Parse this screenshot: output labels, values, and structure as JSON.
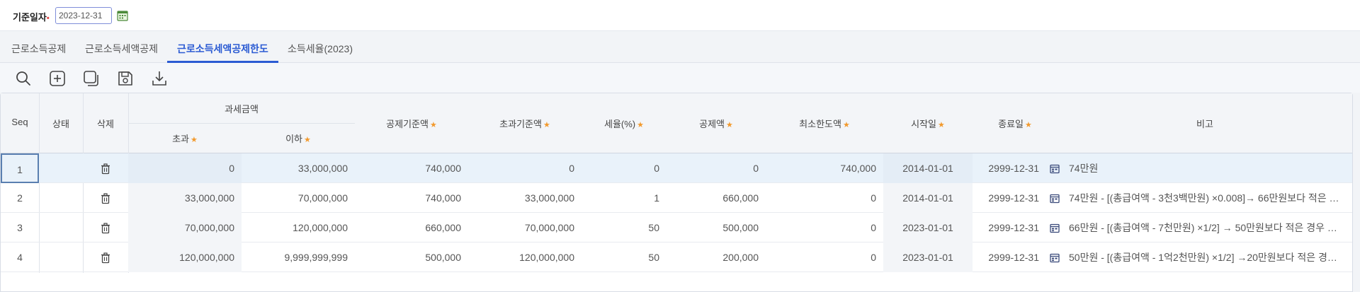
{
  "filter": {
    "label": "기준일자",
    "required_mark": "•",
    "date_value": "2023-12-31"
  },
  "tabs": [
    {
      "label": "근로소득공제"
    },
    {
      "label": "근로소득세액공제"
    },
    {
      "label": "근로소득세액공제한도"
    },
    {
      "label": "소득세율(2023)"
    }
  ],
  "active_tab": 2,
  "toolbar": {
    "icons": [
      "search-icon",
      "add-icon",
      "copy-icon",
      "save-icon",
      "download-icon"
    ]
  },
  "grid": {
    "headers": {
      "seq": "Seq",
      "status": "상태",
      "delete": "삭제",
      "taxable_group": "과세금액",
      "over": "초과",
      "under": "이하",
      "base_amount": "공제기준액",
      "excess_base": "초과기준액",
      "tax_rate": "세율(%)",
      "deduction": "공제액",
      "min_limit": "최소한도액",
      "start_date": "시작일",
      "end_date": "종료일",
      "note": "비고"
    },
    "required_star": "★",
    "rows": [
      {
        "seq": "1",
        "status": "",
        "over": "0",
        "under": "33,000,000",
        "base_amount": "740,000",
        "excess_base": "0",
        "tax_rate": "0",
        "deduction": "0",
        "min_limit": "740,000",
        "start_date": "2014-01-01",
        "end_date": "2999-12-31",
        "note": "74만원"
      },
      {
        "seq": "2",
        "status": "",
        "over": "33,000,000",
        "under": "70,000,000",
        "base_amount": "740,000",
        "excess_base": "33,000,000",
        "tax_rate": "1",
        "deduction": "660,000",
        "min_limit": "0",
        "start_date": "2014-01-01",
        "end_date": "2999-12-31",
        "note": "74만원 - [(총급여액 - 3천3백만원) ×0.008]→ 66만원보다 적은 …"
      },
      {
        "seq": "3",
        "status": "",
        "over": "70,000,000",
        "under": "120,000,000",
        "base_amount": "660,000",
        "excess_base": "70,000,000",
        "tax_rate": "50",
        "deduction": "500,000",
        "min_limit": "0",
        "start_date": "2023-01-01",
        "end_date": "2999-12-31",
        "note": "66만원 - [(총급여액 - 7천만원) ×1/2]  → 50만원보다 적은 경우 …"
      },
      {
        "seq": "4",
        "status": "",
        "over": "120,000,000",
        "under": "9,999,999,999",
        "base_amount": "500,000",
        "excess_base": "120,000,000",
        "tax_rate": "50",
        "deduction": "200,000",
        "min_limit": "0",
        "start_date": "2023-01-01",
        "end_date": "2999-12-31",
        "note": "50만원 - [(총급여액 - 1억2천만원) ×1/2]  →20만원보다 적은 경…"
      }
    ]
  },
  "colors": {
    "accent": "#2b5bd3",
    "required_star": "#f29a2e",
    "selected_row": "#e9f2fa"
  }
}
